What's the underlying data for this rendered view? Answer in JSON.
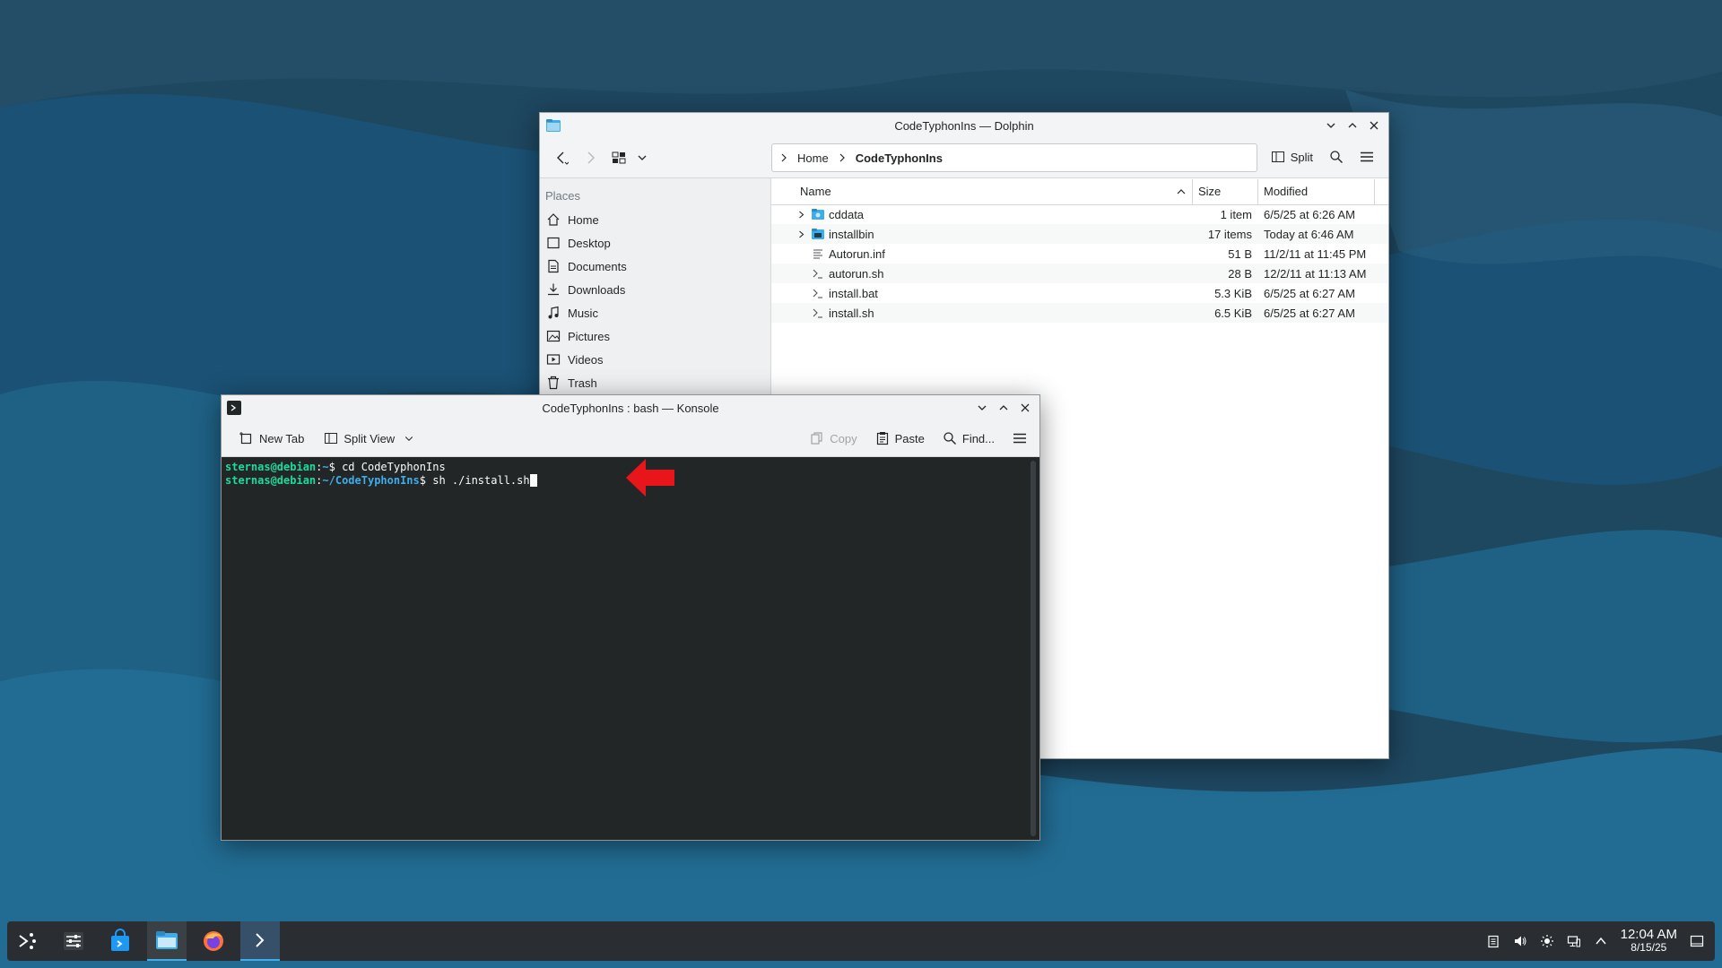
{
  "dolphin": {
    "title": "CodeTyphonIns — Dolphin",
    "breadcrumb": [
      "Home",
      "CodeTyphonIns"
    ],
    "split_label": "Split",
    "places_heading": "Places",
    "places": [
      "Home",
      "Desktop",
      "Documents",
      "Downloads",
      "Music",
      "Pictures",
      "Videos",
      "Trash"
    ],
    "columns": {
      "name": "Name",
      "size": "Size",
      "modified": "Modified"
    },
    "files": [
      {
        "name": "cddata",
        "size": "1 item",
        "modified": "6/5/25 at 6:26 AM",
        "type": "folder"
      },
      {
        "name": "installbin",
        "size": "17 items",
        "modified": "Today at 6:46 AM",
        "type": "folder"
      },
      {
        "name": "Autorun.inf",
        "size": "51 B",
        "modified": "11/2/11 at 11:45 PM",
        "type": "text"
      },
      {
        "name": "autorun.sh",
        "size": "28 B",
        "modified": "12/2/11 at 11:13 AM",
        "type": "script"
      },
      {
        "name": "install.bat",
        "size": "5.3 KiB",
        "modified": "6/5/25 at 6:27 AM",
        "type": "script"
      },
      {
        "name": "install.sh",
        "size": "6.5 KiB",
        "modified": "6/5/25 at 6:27 AM",
        "type": "script"
      }
    ]
  },
  "konsole": {
    "title": "CodeTyphonIns : bash — Konsole",
    "toolbar": {
      "new_tab": "New Tab",
      "split_view": "Split View",
      "copy": "Copy",
      "paste": "Paste",
      "find": "Find..."
    },
    "lines": [
      {
        "user": "sternas@debian",
        "sep": ":",
        "path": "~",
        "prompt": "$ ",
        "cmd": "cd CodeTyphonIns"
      },
      {
        "user": "sternas@debian",
        "sep": ":",
        "path": "~/CodeTyphonIns",
        "prompt": "$ ",
        "cmd": "sh ./install.sh"
      }
    ]
  },
  "taskbar": {
    "time": "12:04 AM",
    "date": "8/15/25"
  },
  "colors": {
    "accent": "#3daee9",
    "terminal_bg": "#232627",
    "prompt_user": "#1cdc9a",
    "prompt_path": "#3daee9",
    "annotation_arrow": "#e8151b"
  }
}
